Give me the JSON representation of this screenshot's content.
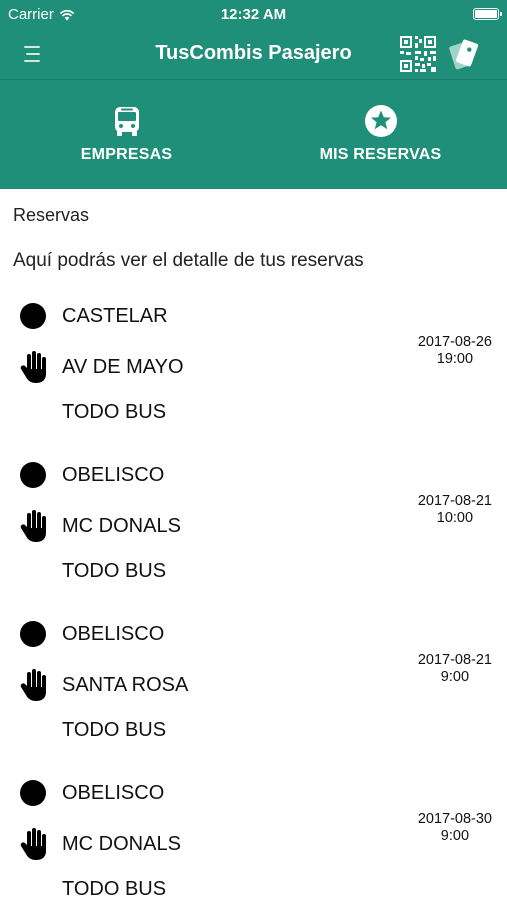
{
  "status_bar": {
    "carrier": "Carrier",
    "time": "12:32 AM"
  },
  "nav": {
    "title": "TusCombis Pasajero",
    "icons": [
      "menu-icon",
      "qr-code-icon",
      "card-icon"
    ]
  },
  "tabs": [
    {
      "label": "EMPRESAS",
      "icon": "bus-icon",
      "active": false
    },
    {
      "label": "MIS RESERVAS",
      "icon": "star-icon",
      "active": true
    }
  ],
  "content": {
    "title": "Reservas",
    "description": "Aquí podrás ver el detalle de tus reservas"
  },
  "reservations": [
    {
      "origin": "CASTELAR",
      "destination": "AV DE MAYO",
      "company": "TODO BUS",
      "date": "2017-08-26",
      "time": "19:00"
    },
    {
      "origin": "OBELISCO",
      "destination": "MC DONALS",
      "company": "TODO BUS",
      "date": "2017-08-21",
      "time": "10:00"
    },
    {
      "origin": "OBELISCO",
      "destination": "SANTA ROSA",
      "company": "TODO BUS",
      "date": "2017-08-21",
      "time": "9:00"
    },
    {
      "origin": "OBELISCO",
      "destination": "MC DONALS",
      "company": "TODO BUS",
      "date": "2017-08-30",
      "time": "9:00"
    }
  ],
  "colors": {
    "primary": "#1f8f79",
    "indicator": "#ffffff"
  }
}
